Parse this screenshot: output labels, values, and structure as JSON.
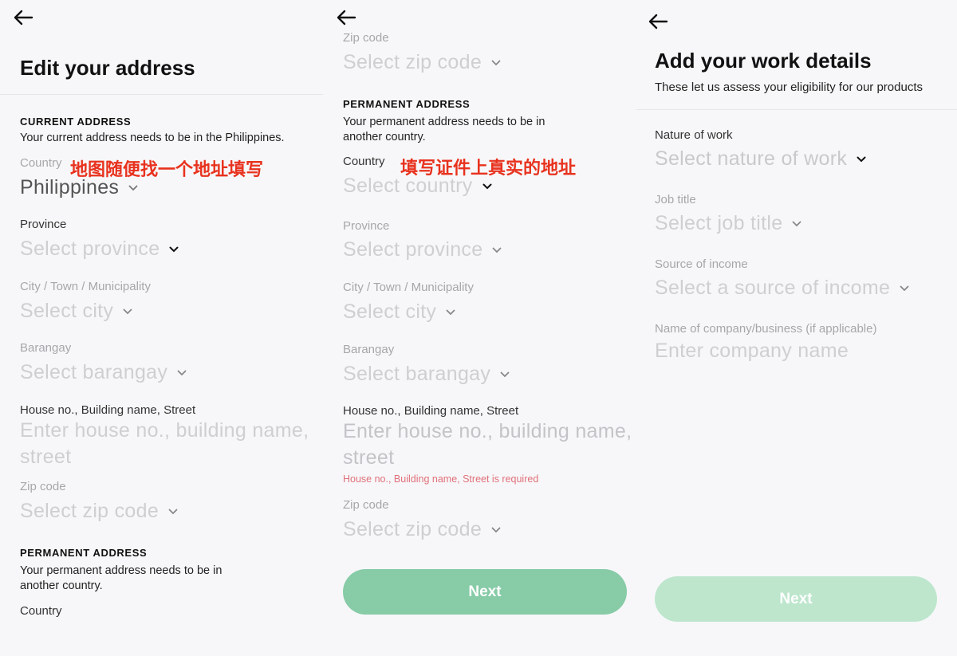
{
  "screen1": {
    "title": "Edit your address",
    "current_section": "CURRENT ADDRESS",
    "current_desc": "Your current address needs to be in the Philippines.",
    "country_label": "Country",
    "country_value": "Philippines",
    "annotation": "地图随便找一个地址填写",
    "province_label": "Province",
    "province_placeholder": "Select province",
    "city_label": "City / Town / Municipality",
    "city_placeholder": "Select city",
    "barangay_label": "Barangay",
    "barangay_placeholder": "Select barangay",
    "house_label": "House no., Building name, Street",
    "house_placeholder": "Enter house no., building name, street",
    "zip_label": "Zip code",
    "zip_placeholder": "Select zip code",
    "permanent_section": "PERMANENT ADDRESS",
    "permanent_desc": "Your permanent address needs to be in another country.",
    "permanent_country_label": "Country"
  },
  "screen2": {
    "zip_label_top": "Zip code",
    "zip_placeholder_top": "Select zip code",
    "permanent_section": "PERMANENT ADDRESS",
    "permanent_desc": "Your permanent address needs to be in another country.",
    "country_label": "Country",
    "annotation": "填写证件上真实的地址",
    "country_placeholder": "Select country",
    "province_label": "Province",
    "province_placeholder": "Select province",
    "city_label": "City / Town / Municipality",
    "city_placeholder": "Select city",
    "barangay_label": "Barangay",
    "barangay_placeholder": "Select barangay",
    "house_label": "House no., Building name, Street",
    "house_placeholder": "Enter house no., building name, street",
    "house_error": "House no., Building name, Street is required",
    "zip_label": "Zip code",
    "zip_placeholder": "Select zip code",
    "next_label": "Next"
  },
  "screen3": {
    "title": "Add your work details",
    "subtitle": "These let us assess your eligibility for our products",
    "nature_label": "Nature of work",
    "nature_placeholder": "Select nature of work",
    "job_label": "Job title",
    "job_placeholder": "Select job title",
    "income_label": "Source of income",
    "income_placeholder": "Select a source of income",
    "company_label": "Name of company/business (if applicable)",
    "company_placeholder": "Enter company name",
    "next_label": "Next"
  },
  "colors": {
    "accent_green": "#87cba7",
    "accent_green_disabled": "#bde6cd",
    "annotation_red": "#e8321e",
    "error_red": "#e0707a",
    "placeholder_gray": "#cfcfd2"
  },
  "icons": {
    "back": "arrow-left-icon",
    "dropdown": "chevron-down-icon"
  }
}
